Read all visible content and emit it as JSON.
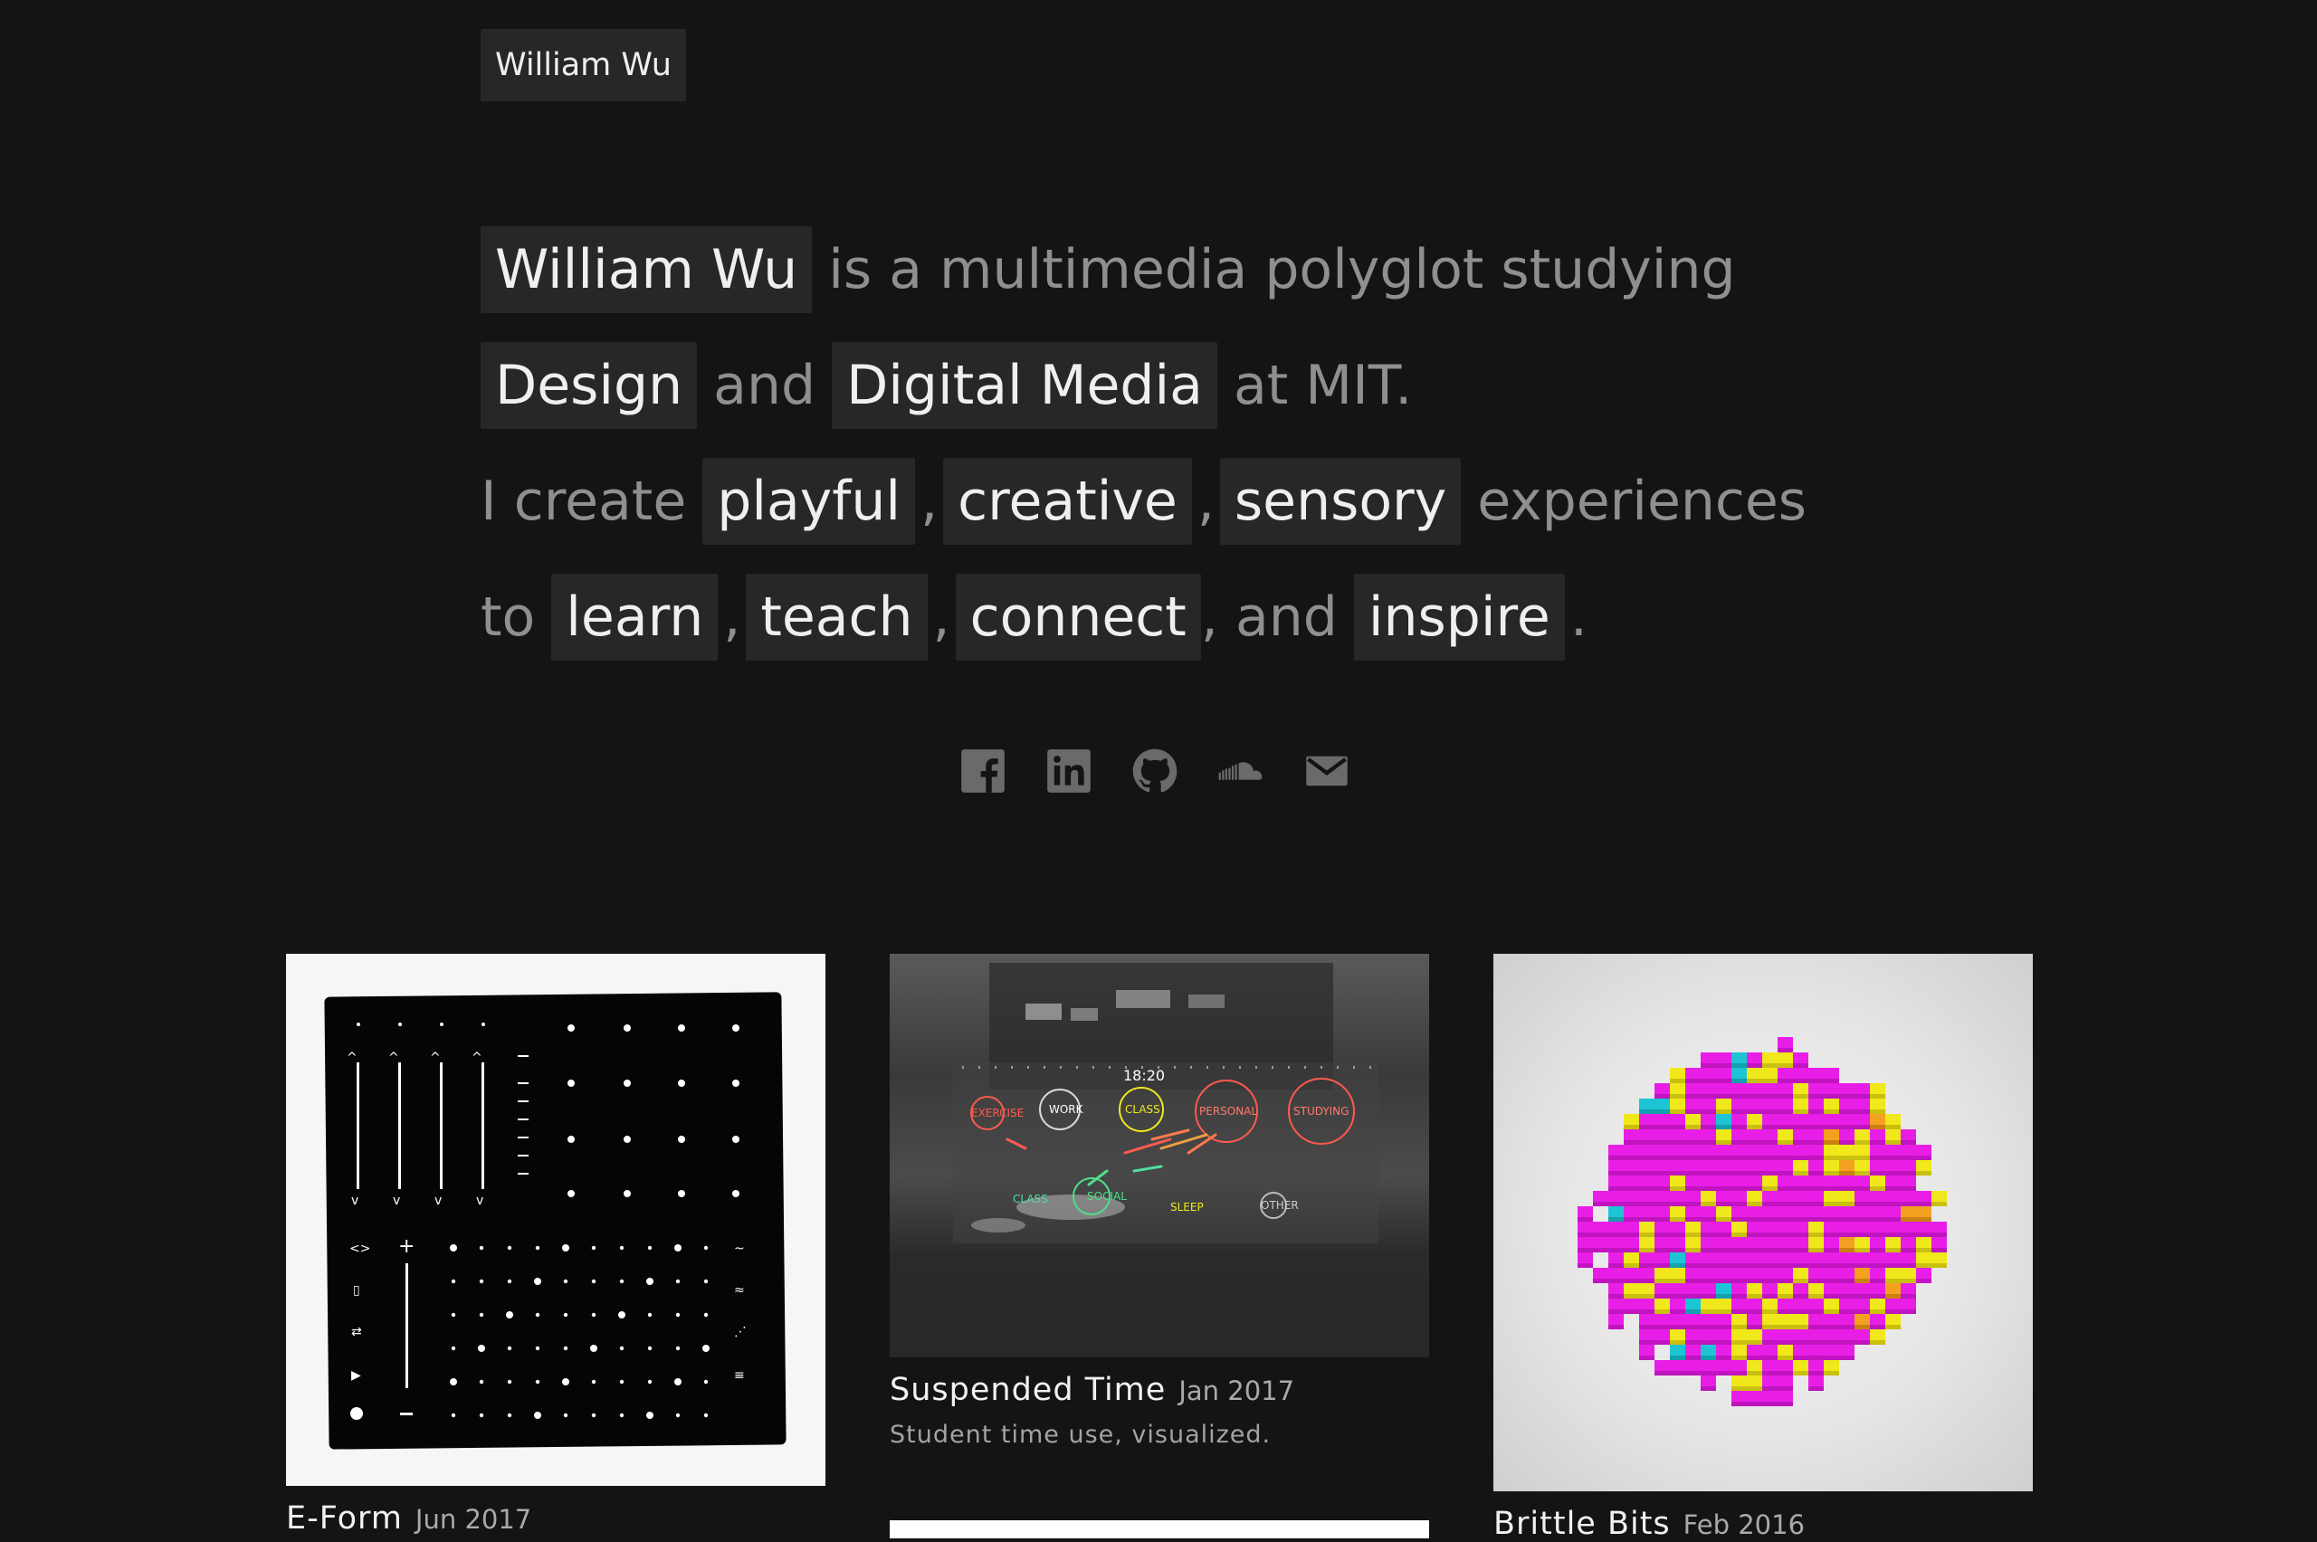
{
  "header": {
    "name": "William Wu"
  },
  "intro": {
    "l1_name": "William Wu",
    "l1_rest": "is a multimedia polyglot studying",
    "l2_design": "Design",
    "l2_and": "and",
    "l2_dm": "Digital Media",
    "l2_mit": "at MIT.",
    "l3_icreate": "I create",
    "l3_playful": "playful",
    "l3_creative": "creative",
    "l3_sensory": "sensory",
    "l3_experiences": "experiences",
    "l4_to": "to",
    "l4_learn": "learn",
    "l4_teach": "teach",
    "l4_connect": "connect",
    "l4_and": ", and",
    "l4_inspire": "inspire",
    "comma": ",",
    "period": "."
  },
  "socials": [
    {
      "icon": "facebook-icon"
    },
    {
      "icon": "linkedin-icon"
    },
    {
      "icon": "github-icon"
    },
    {
      "icon": "soundcloud-icon"
    },
    {
      "icon": "email-icon"
    }
  ],
  "projects": [
    {
      "title": "E-Form",
      "date": "Jun 2017",
      "desc": ""
    },
    {
      "title": "Suspended Time",
      "date": "Jan 2017",
      "desc": "Student time use, visualized.",
      "overlay": {
        "time": "18:20",
        "labels": [
          "EXERCISE",
          "WORK",
          "CLASS",
          "PERSONAL",
          "STUDYING",
          "CLASS",
          "SOCIAL",
          "SLEEP",
          "OTHER"
        ]
      }
    },
    {
      "title": "Brittle Bits",
      "date": "Feb 2016",
      "desc": ""
    }
  ],
  "colors": {
    "background": "#141414",
    "pill": "#272727",
    "muted_text": "#8f8f8f",
    "magenta": "#e81ee6",
    "yellow": "#f0e81a",
    "cyan": "#1cc4d4"
  }
}
